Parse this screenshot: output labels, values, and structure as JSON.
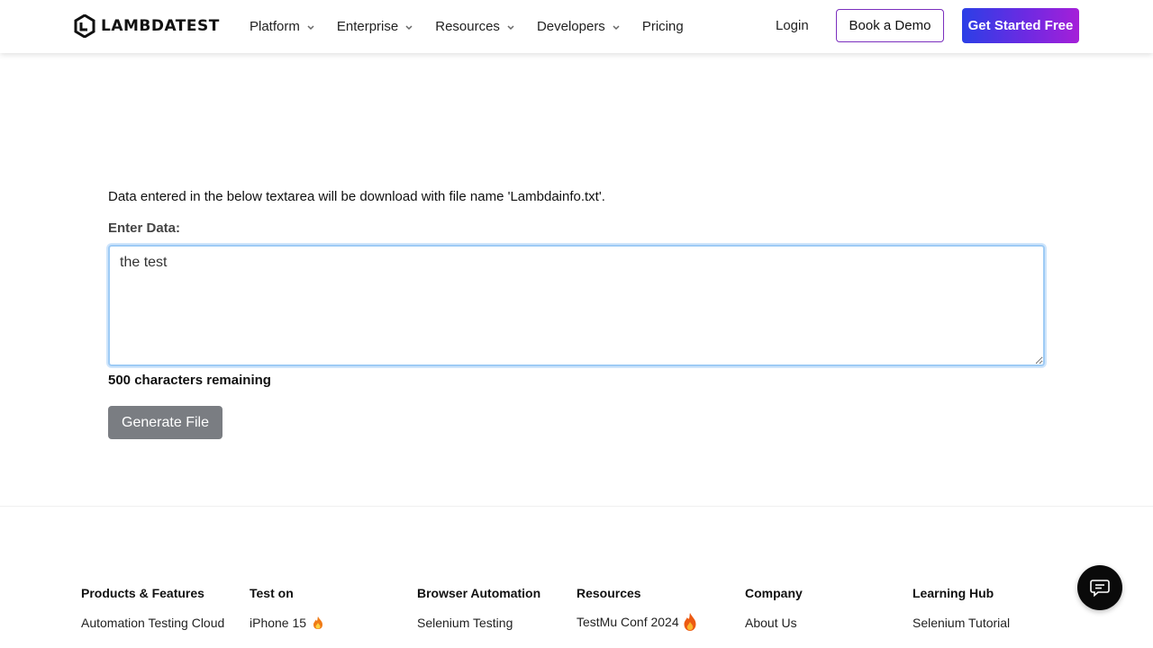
{
  "header": {
    "logo_text": "LAMBDATEST",
    "nav": [
      {
        "label": "Platform",
        "has_dropdown": true
      },
      {
        "label": "Enterprise",
        "has_dropdown": true
      },
      {
        "label": "Resources",
        "has_dropdown": true
      },
      {
        "label": "Developers",
        "has_dropdown": true
      },
      {
        "label": "Pricing",
        "has_dropdown": false
      }
    ],
    "login_label": "Login",
    "demo_label": "Book a Demo",
    "start_label": "Get Started Free"
  },
  "form": {
    "info_text": "Data entered in the below textarea will be download with file name 'Lambdainfo.txt'.",
    "label": "Enter Data:",
    "textarea_value": "the test",
    "remaining_text": "500 characters remaining",
    "generate_label": "Generate File"
  },
  "footer": {
    "columns": [
      {
        "title": "Products & Features",
        "links": [
          "Automation Testing Cloud"
        ]
      },
      {
        "title": "Test on",
        "links": [
          "iPhone 15"
        ]
      },
      {
        "title": "Browser Automation",
        "links": [
          "Selenium Testing"
        ]
      },
      {
        "title": "Resources",
        "links": [
          "TestMu Conf 2024"
        ]
      },
      {
        "title": "Company",
        "links": [
          "About Us"
        ]
      },
      {
        "title": "Learning Hub",
        "links": [
          "Selenium Tutorial"
        ]
      }
    ]
  },
  "colors": {
    "brand_gradient_start": "#2b3fe6",
    "brand_gradient_end": "#a51fd8",
    "generate_button": "#7a7d82",
    "focus_border": "#9ecbf5"
  },
  "icons": [
    "chevron-down-icon",
    "fire-icon",
    "chat-icon",
    "lambdatest-logo-icon"
  ]
}
